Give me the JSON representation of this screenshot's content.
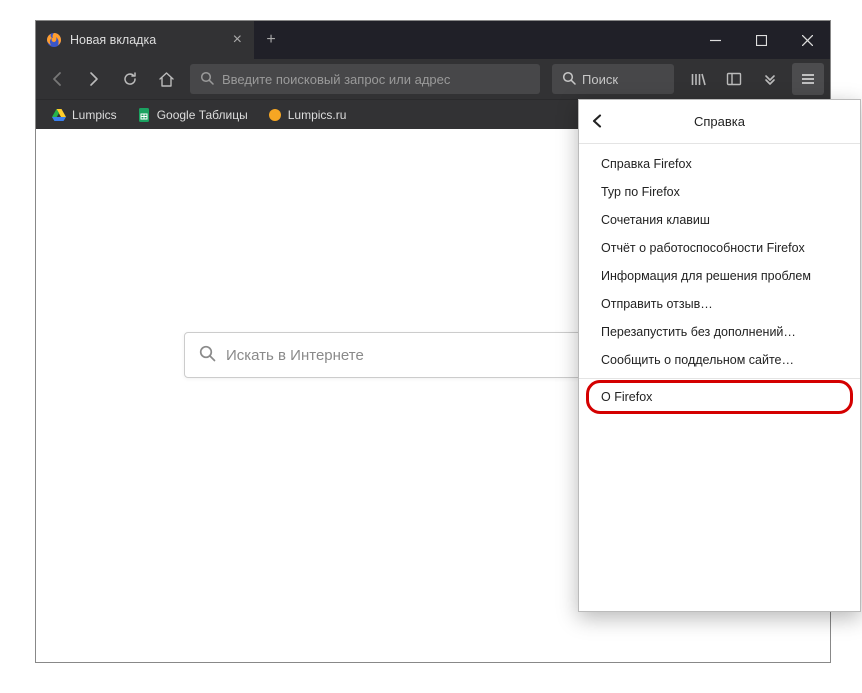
{
  "tab": {
    "title": "Новая вкладка"
  },
  "urlbar": {
    "placeholder": "Введите поисковый запрос или адрес"
  },
  "searchbar": {
    "placeholder": "Поиск"
  },
  "bookmarks": [
    {
      "label": "Lumpics"
    },
    {
      "label": "Google Таблицы"
    },
    {
      "label": "Lumpics.ru"
    }
  ],
  "center_search": {
    "placeholder": "Искать в Интернете"
  },
  "help_panel": {
    "title": "Справка",
    "items": [
      "Справка Firefox",
      "Тур по Firefox",
      "Сочетания клавиш",
      "Отчёт о работоспособности Firefox",
      "Информация для решения проблем",
      "Отправить отзыв…",
      "Перезапустить без дополнений…",
      "Сообщить о поддельном сайте…"
    ],
    "about": "О Firefox"
  }
}
